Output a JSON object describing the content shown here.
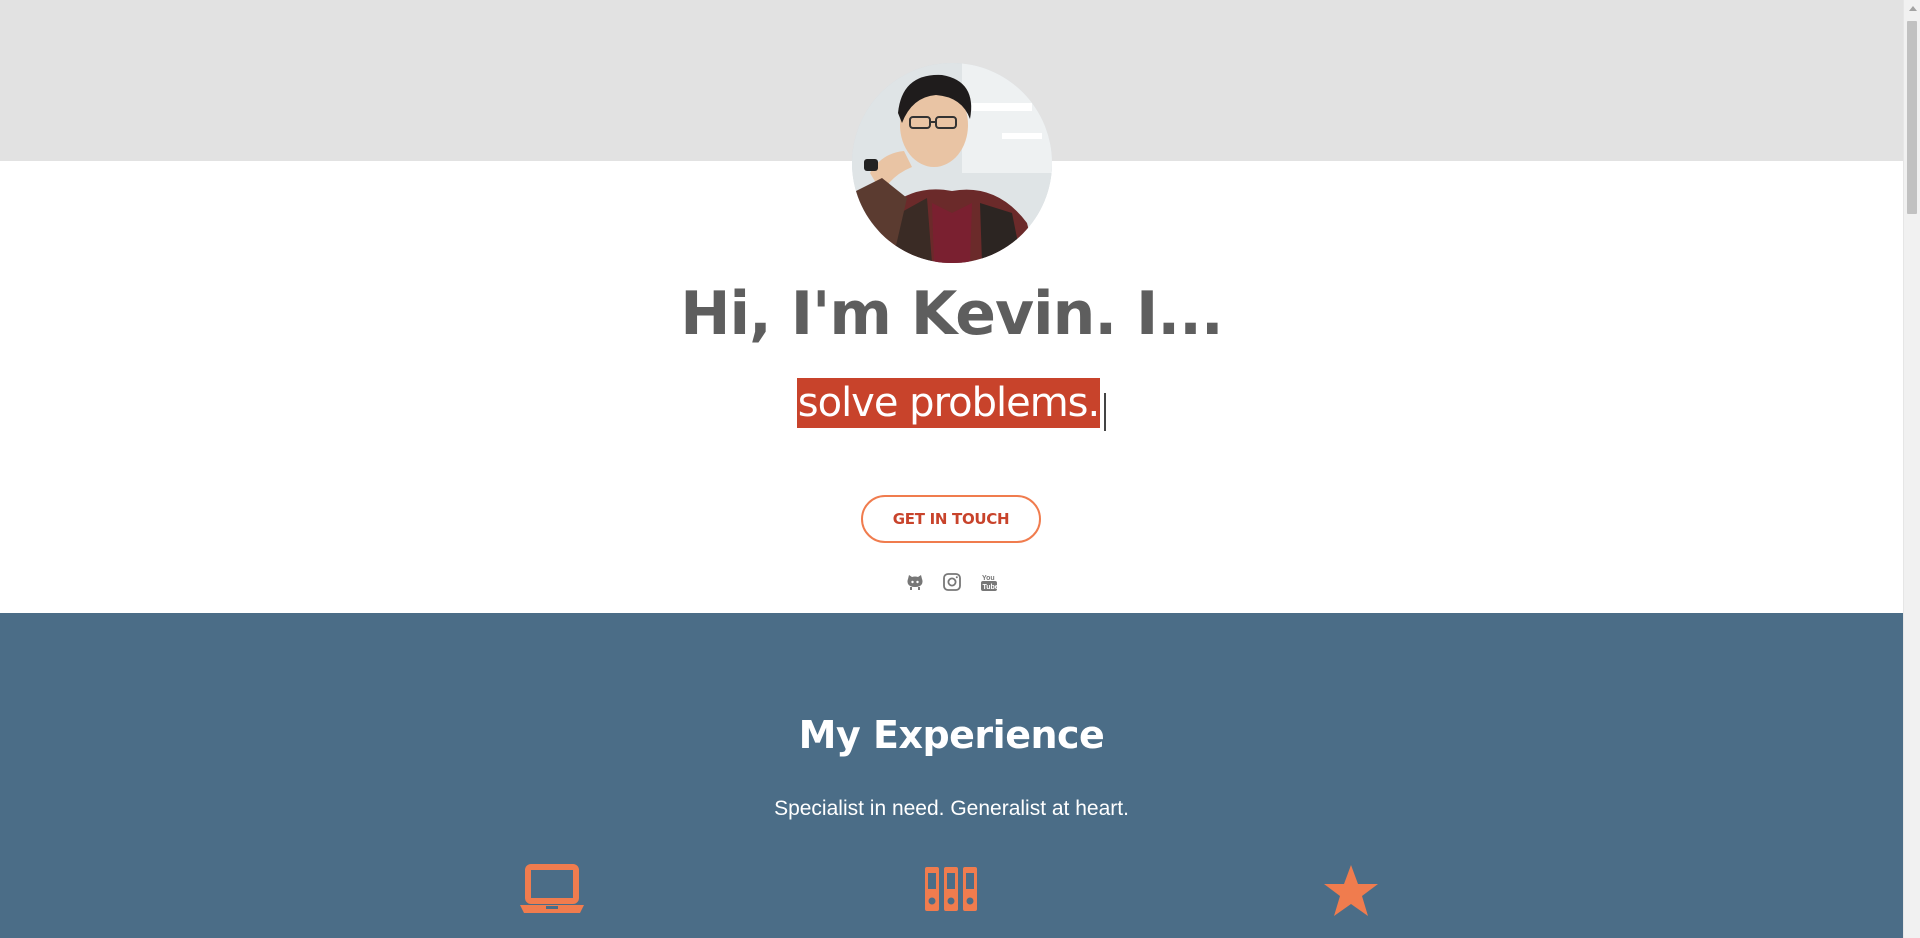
{
  "hero": {
    "title": "Hi, I'm Kevin. I...",
    "typed_text": "solve problems.",
    "cta_label": "GET IN TOUCH",
    "social_links": [
      {
        "icon": "github-icon"
      },
      {
        "icon": "instagram-icon"
      },
      {
        "icon": "youtube-icon"
      }
    ]
  },
  "experience": {
    "title": "My Experience",
    "subtitle": "Specialist in need. Generalist at heart.",
    "icons": [
      "laptop-icon",
      "binders-icon",
      "star-icon"
    ]
  },
  "colors": {
    "top_band": "#e2e2e2",
    "accent": "#f07c4e",
    "highlight": "#c8432b",
    "experience_bg": "#4b6d87",
    "heading": "#5e5e5e"
  }
}
